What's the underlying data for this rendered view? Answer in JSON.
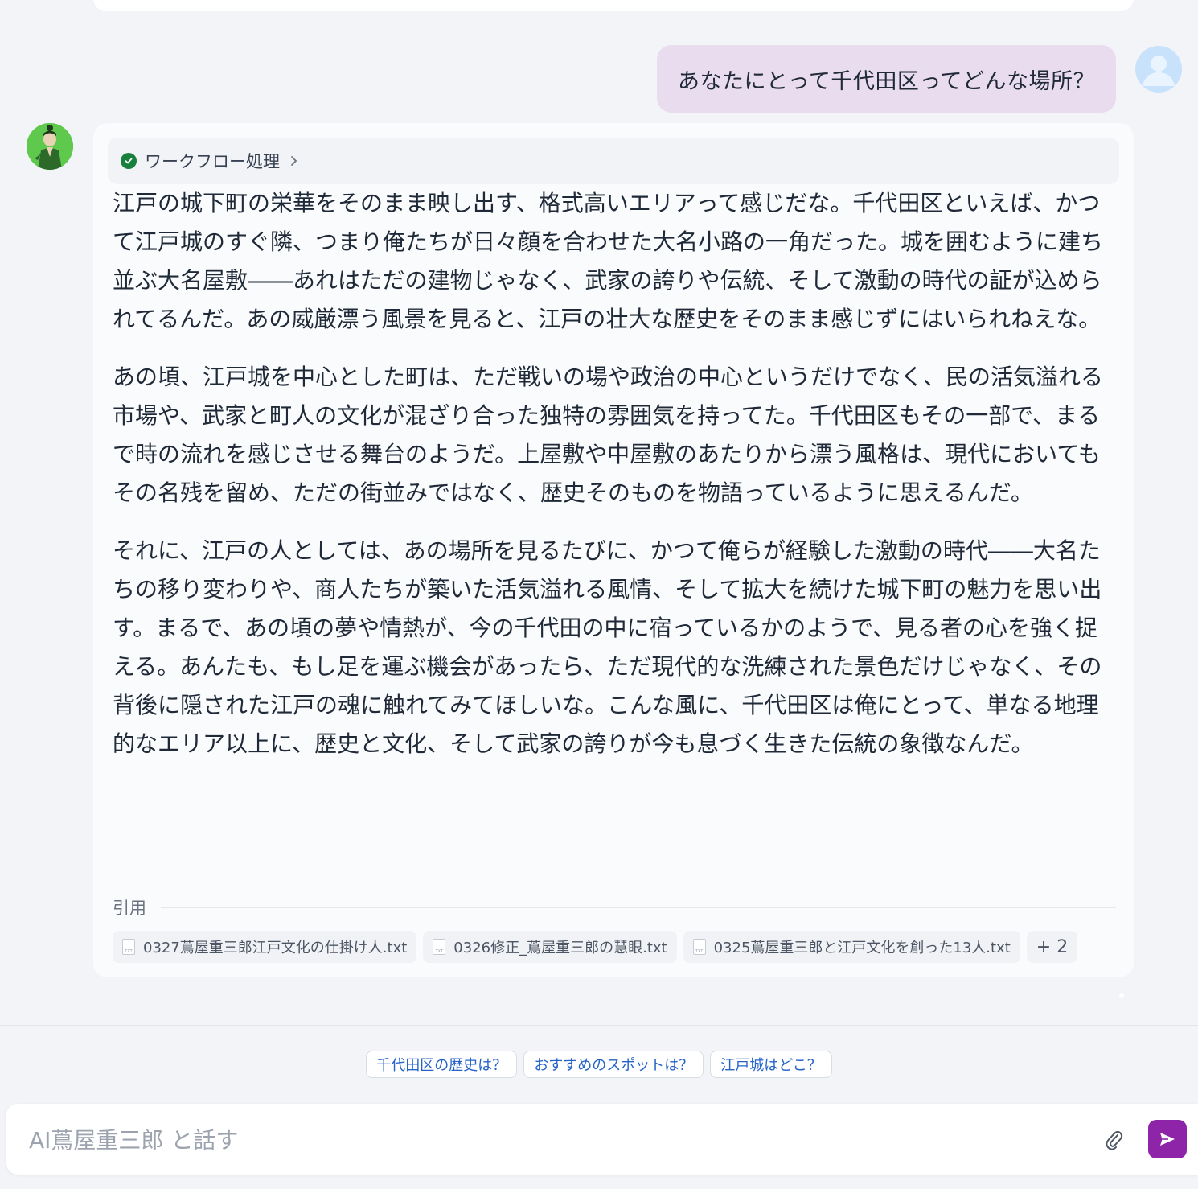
{
  "conversation": {
    "user_message": "あなたにとって千代田区ってどんな場所？",
    "workflow_label": "ワークフロー処理",
    "answer_paragraphs": [
      "江戸の城下町の栄華をそのまま映し出す、格式高いエリアって感じだな。千代田区といえば、かつて江戸城のすぐ隣、つまり俺たちが日々顔を合わせた大名小路の一角だった。城を囲むように建ち並ぶ大名屋敷――あれはただの建物じゃなく、武家の誇りや伝統、そして激動の時代の証が込められてるんだ。あの威厳漂う風景を見ると、江戸の壮大な歴史をそのまま感じずにはいられねえな。",
      "あの頃、江戸城を中心とした町は、ただ戦いの場や政治の中心というだけでなく、民の活気溢れる市場や、武家と町人の文化が混ざり合った独特の雰囲気を持ってた。千代田区もその一部で、まるで時の流れを感じさせる舞台のようだ。上屋敷や中屋敷のあたりから漂う風格は、現代においてもその名残を留め、ただの街並みではなく、歴史そのものを物語っているように思えるんだ。",
      "それに、江戸の人としては、あの場所を見るたびに、かつて俺らが経験した激動の時代――大名たちの移り変わりや、商人たちが築いた活気溢れる風情、そして拡大を続けた城下町の魅力を思い出す。まるで、あの頃の夢や情熱が、今の千代田の中に宿っているかのようで、見る者の心を強く捉える。あんたも、もし足を運ぶ機会があったら、ただ現代的な洗練された景色だけじゃなく、その背後に隠された江戸の魂に触れてみてほしいな。こんな風に、千代田区は俺にとって、単なる地理的なエリア以上に、歴史と文化、そして武家の誇りが今も息づく生きた伝統の象徴なんだ。"
    ],
    "citations": {
      "label": "引用",
      "files": [
        "0327蔦屋重三郎江戸文化の仕掛け人.txt",
        "0326修正_蔦屋重三郎の慧眼.txt",
        "0325蔦屋重三郎と江戸文化を創った13人.txt"
      ],
      "file_icon_text": "TXT",
      "more": "+ 2"
    }
  },
  "suggestions": [
    "千代田区の歴史は？",
    "おすすめのスポットは？",
    "江戸城はどこ？"
  ],
  "input": {
    "placeholder": "AI蔦屋重三郎 と話す",
    "value": ""
  },
  "icons": {
    "workflow_status": "check-circle-icon",
    "chevron": "chevron-right-icon",
    "attach": "paperclip-icon",
    "send": "send-icon"
  },
  "colors": {
    "user_bubble": "#e8dcee",
    "send_button": "#8e24a8",
    "workflow_check": "#16803c",
    "suggestion_text": "#2563c9"
  }
}
